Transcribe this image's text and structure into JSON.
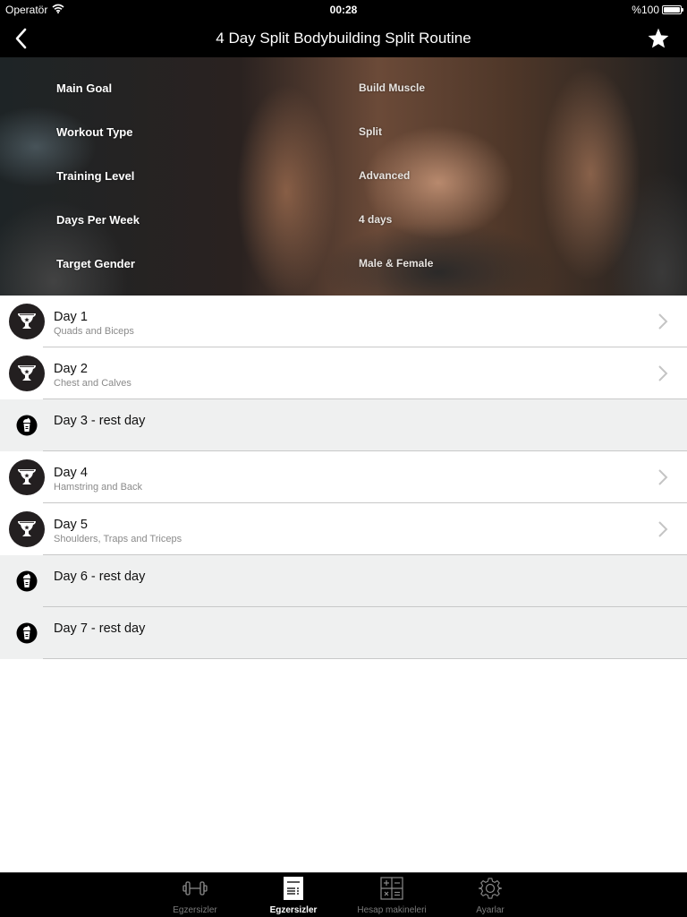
{
  "status_bar": {
    "carrier": "Operatör",
    "time": "00:28",
    "battery_text": "%100",
    "battery_level": 1.0
  },
  "nav_bar": {
    "title": "4 Day Split Bodybuilding Split Routine",
    "back_icon": "chevron-left-icon",
    "favorite_icon": "star-icon"
  },
  "overview": [
    {
      "label": "Main Goal",
      "value": "Build Muscle"
    },
    {
      "label": "Workout Type",
      "value": "Split"
    },
    {
      "label": "Training Level",
      "value": "Advanced"
    },
    {
      "label": "Days Per Week",
      "value": "4 days"
    },
    {
      "label": "Target Gender",
      "value": "Male & Female"
    }
  ],
  "days": [
    {
      "title": "Day 1",
      "subtitle": "Quads and Biceps",
      "type": "workout",
      "icon": "trophy-icon"
    },
    {
      "title": "Day 2",
      "subtitle": "Chest and Calves",
      "type": "workout",
      "icon": "trophy-icon"
    },
    {
      "title": "Day 3  - rest day",
      "subtitle": "",
      "type": "rest",
      "icon": "shaker-bottle-icon"
    },
    {
      "title": "Day 4",
      "subtitle": "Hamstring and Back",
      "type": "workout",
      "icon": "trophy-icon"
    },
    {
      "title": "Day 5",
      "subtitle": "Shoulders, Traps and Triceps",
      "type": "workout",
      "icon": "trophy-icon"
    },
    {
      "title": "Day 6 - rest day",
      "subtitle": "",
      "type": "rest",
      "icon": "shaker-bottle-icon"
    },
    {
      "title": "Day 7 - rest day",
      "subtitle": "",
      "type": "rest",
      "icon": "shaker-bottle-icon"
    }
  ],
  "tab_bar": {
    "tabs": [
      {
        "label": "Egzersizler",
        "icon": "dumbbell-icon",
        "active": false
      },
      {
        "label": "Egzersizler",
        "icon": "workout-list-icon",
        "active": true
      },
      {
        "label": "Hesap makineleri",
        "icon": "calculator-icon",
        "active": false
      },
      {
        "label": "Ayarlar",
        "icon": "gear-icon",
        "active": false
      }
    ]
  },
  "colors": {
    "bar_background": "#000000",
    "rest_row_background": "#eff0f0",
    "separator": "#c8c8c8",
    "subtitle_text": "#8a8a8a",
    "icon_circle": "#231f20",
    "tab_inactive": "#7c7c7c",
    "tab_active": "#ffffff"
  }
}
